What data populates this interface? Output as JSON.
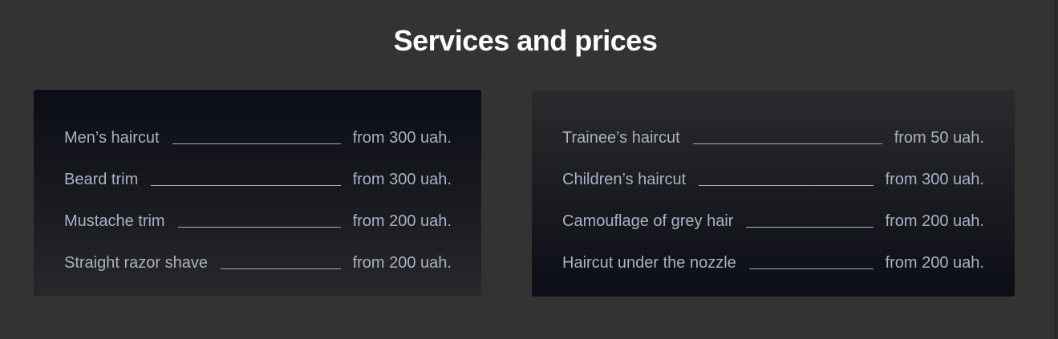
{
  "section": {
    "title": "Services and prices"
  },
  "price_lists": [
    {
      "items": [
        {
          "name": "Men’s haircut",
          "price": "from 300 uah."
        },
        {
          "name": "Beard trim",
          "price": "from 300 uah."
        },
        {
          "name": "Mustache trim",
          "price": "from 200 uah."
        },
        {
          "name": "Straight razor shave",
          "price": "from 200 uah."
        }
      ]
    },
    {
      "items": [
        {
          "name": "Trainee’s haircut",
          "price": "from 50 uah."
        },
        {
          "name": "Children’s haircut",
          "price": "from 300 uah."
        },
        {
          "name": "Camouflage of grey hair",
          "price": "from 200 uah."
        },
        {
          "name": "Haircut under the nozzle",
          "price": "from 200 uah."
        }
      ]
    }
  ],
  "colors": {
    "background": "#333333",
    "title": "#ffffff",
    "text": "#a9b1c3",
    "card_dark": "#0b0e15"
  }
}
